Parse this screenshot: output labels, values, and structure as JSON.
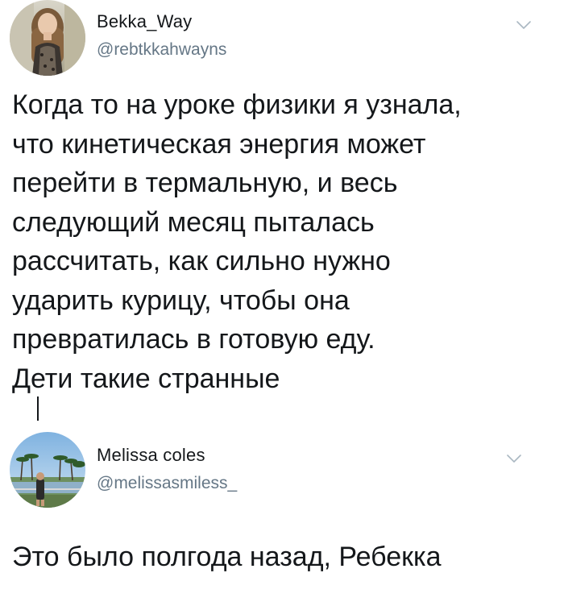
{
  "tweets": [
    {
      "display_name": "Bekka_Way",
      "handle": "@rebtkkahwayns",
      "avatar_icon": "profile-photo-woman-long-hair",
      "menu_icon": "chevron-down-icon",
      "text_lines": [
        "Когда то на уроке физики я узнала,",
        "что кинетическая энергия может",
        "перейти в термальную, и весь",
        "следующий месяц пыталась",
        "рассчитать, как сильно нужно",
        "ударить курицу, чтобы она",
        "превратилась в готовую еду.",
        "Дети такие странные"
      ]
    },
    {
      "display_name": "Melissa coles",
      "handle": "@melissasmiless_",
      "avatar_icon": "profile-photo-palm-trees-outdoor",
      "menu_icon": "chevron-down-icon",
      "text_lines": [
        "Это было полгода назад, Ребекка"
      ]
    }
  ],
  "colors": {
    "text_primary": "#14171a",
    "text_secondary": "#657786",
    "chevron": "#aab8c2",
    "background": "#ffffff"
  }
}
